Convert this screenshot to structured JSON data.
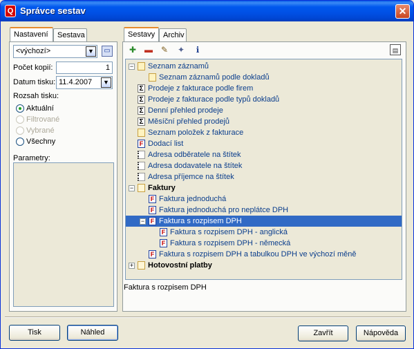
{
  "window": {
    "title": "Správce sestav",
    "icon": "app-icon-letter",
    "close_label": "✕"
  },
  "left_tabs": [
    {
      "label": "Nastavení",
      "active": true
    },
    {
      "label": "Sestava",
      "active": false
    }
  ],
  "left": {
    "profile_value": "<výchozí>",
    "copies_label": "Počet kopií:",
    "copies_value": "1",
    "date_label": "Datum tisku:",
    "date_value": "11.4.2007",
    "range_label": "Rozsah tisku:",
    "radios": [
      {
        "label": "Aktuální",
        "checked": true,
        "disabled": false
      },
      {
        "label": "Filtrované",
        "checked": false,
        "disabled": true
      },
      {
        "label": "Vybrané",
        "checked": false,
        "disabled": true
      },
      {
        "label": "Všechny",
        "checked": false,
        "disabled": false
      }
    ],
    "params_label": "Parametry:"
  },
  "right_tabs": [
    {
      "label": "Sestavy",
      "active": true
    },
    {
      "label": "Archiv",
      "active": false
    }
  ],
  "toolbar": {
    "icons": [
      "add-report-icon",
      "delete-report-icon",
      "edit-report-icon",
      "report-properties-icon",
      "report-info-icon"
    ],
    "right_icon": "view-options-icon"
  },
  "tree": {
    "items": [
      {
        "text": "Seznam záznamů",
        "icon": "doc",
        "level": 0,
        "expander": "−",
        "bold": false,
        "selected": false
      },
      {
        "text": "Seznam záznamů podle dokladů",
        "icon": "doc",
        "level": 1,
        "expander": "",
        "bold": false,
        "selected": false
      },
      {
        "text": "Prodeje z fakturace podle firem",
        "icon": "sigma",
        "level": 0,
        "expander": "",
        "bold": false,
        "selected": false
      },
      {
        "text": "Prodeje z fakturace podle typů dokladů",
        "icon": "sigma",
        "level": 0,
        "expander": "",
        "bold": false,
        "selected": false
      },
      {
        "text": "Denní přehled prodeje",
        "icon": "sigma",
        "level": 0,
        "expander": "",
        "bold": false,
        "selected": false
      },
      {
        "text": "Měsíční přehled prodejů",
        "icon": "sigma",
        "level": 0,
        "expander": "",
        "bold": false,
        "selected": false
      },
      {
        "text": "Seznam položek z fakturace",
        "icon": "doc",
        "level": 0,
        "expander": "",
        "bold": false,
        "selected": false
      },
      {
        "text": "Dodací list",
        "icon": "f",
        "level": 0,
        "expander": "",
        "bold": false,
        "selected": false
      },
      {
        "text": "Adresa odběratele na štítek",
        "icon": "label",
        "level": 0,
        "expander": "",
        "bold": false,
        "selected": false
      },
      {
        "text": "Adresa dodavatele na štítek",
        "icon": "label",
        "level": 0,
        "expander": "",
        "bold": false,
        "selected": false
      },
      {
        "text": "Adresa příjemce na štítek",
        "icon": "label",
        "level": 0,
        "expander": "",
        "bold": false,
        "selected": false
      },
      {
        "text": "Faktury",
        "icon": "folder",
        "level": 0,
        "expander": "−",
        "bold": true,
        "selected": false
      },
      {
        "text": "Faktura jednoduchá",
        "icon": "f",
        "level": 1,
        "expander": "",
        "bold": false,
        "selected": false
      },
      {
        "text": "Faktura jednoduchá pro neplátce DPH",
        "icon": "f",
        "level": 1,
        "expander": "",
        "bold": false,
        "selected": false
      },
      {
        "text": "Faktura s rozpisem DPH",
        "icon": "f",
        "level": 1,
        "expander": "−",
        "bold": false,
        "selected": true
      },
      {
        "text": "Faktura s rozpisem DPH - anglická",
        "icon": "f",
        "level": 2,
        "expander": "",
        "bold": false,
        "selected": false
      },
      {
        "text": "Faktura s rozpisem DPH - německá",
        "icon": "f",
        "level": 2,
        "expander": "",
        "bold": false,
        "selected": false
      },
      {
        "text": "Faktura s rozpisem DPH a tabulkou DPH ve výchozí měně",
        "icon": "f",
        "level": 1,
        "expander": "",
        "bold": false,
        "selected": false
      },
      {
        "text": "Hotovostní platby",
        "icon": "folder",
        "level": 0,
        "expander": "+",
        "bold": true,
        "selected": false
      }
    ]
  },
  "description": "Faktura s rozpisem DPH",
  "buttons": {
    "print": "Tisk",
    "preview": "Náhled",
    "close": "Zavřít",
    "help": "Nápověda"
  }
}
